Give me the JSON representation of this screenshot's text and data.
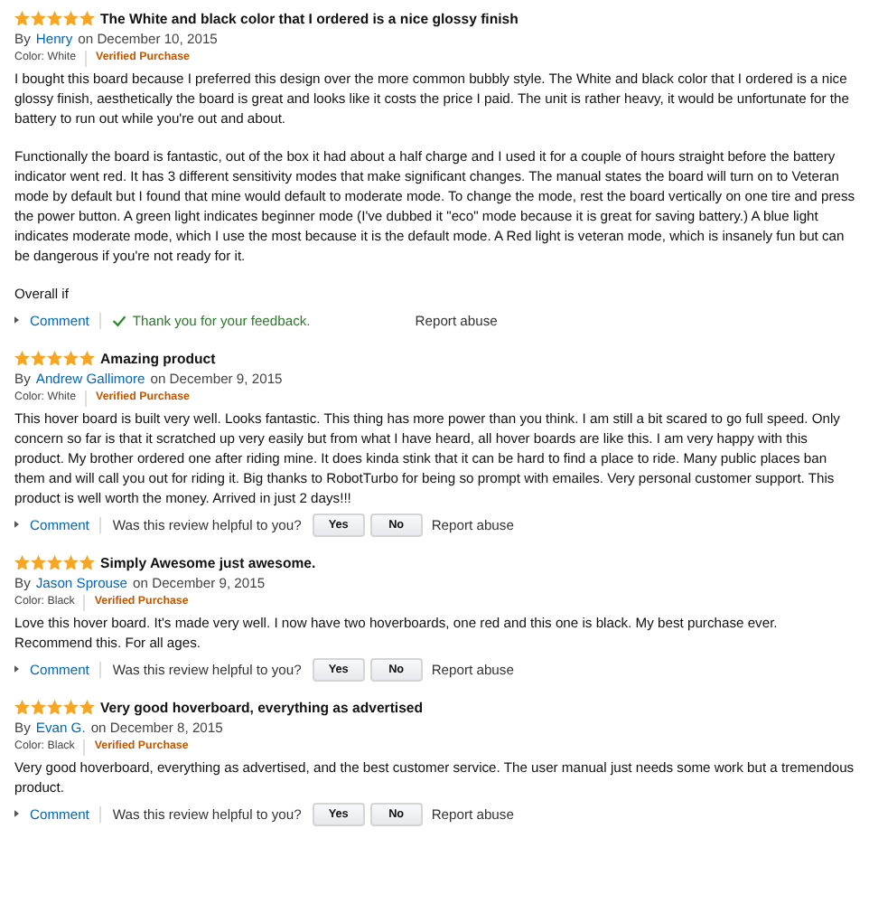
{
  "reviews": [
    {
      "stars": 5,
      "title": "The White and black color that I ordered is a nice glossy finish",
      "by": "By",
      "author": "Henry",
      "date": "on December 10, 2015",
      "variant": "Color: White",
      "verified": "Verified Purchase",
      "paragraphs": [
        "I bought this board because I preferred this design over the more common bubbly style. The White and black color that I ordered is a nice glossy finish, aesthetically the board is great and looks like it costs the price I paid. The unit is rather heavy, it would be unfortunate for the battery to run out while you're out and about.",
        "Functionally the board is fantastic, out of the box it had about a half charge and I used it for a couple of hours straight before the battery indicator went red. It has 3 different sensitivity modes that make significant changes. The manual states the board will turn on to Veteran mode by default but I found that mine would default to moderate mode. To change the mode, rest the board vertically on one tire and press the power button. A green light indicates beginner mode (I've dubbed it \"eco\" mode because it is great for saving battery.) A blue light indicates moderate mode, which I use the most because it is the default mode. A Red light is veteran mode, which is insanely fun but can be dangerous if you're not ready for it.",
        "Overall if"
      ],
      "footer": {
        "kind": "thanked",
        "comment": "Comment",
        "message": "Thank you for your feedback.",
        "report": "Report abuse"
      }
    },
    {
      "stars": 5,
      "title": "Amazing product",
      "by": "By",
      "author": "Andrew Gallimore",
      "date": "on December 9, 2015",
      "variant": "Color: White",
      "verified": "Verified Purchase",
      "paragraphs": [
        "This hover board is built very well. Looks fantastic. This thing has more power than you think. I am still a bit scared to go full speed. Only concern so far is that it scratched up very easily but from what I have heard, all hover boards are like this. I am very happy with this product. My brother ordered one after riding mine. It does kinda stink that it can be hard to find a place to ride. Many public places ban them and will call you out for riding it. Big thanks to RobotTurbo for being so prompt with emailes. Very personal customer support. This product is well worth the money. Arrived in just 2 days!!!"
      ],
      "footer": {
        "kind": "vote",
        "comment": "Comment",
        "message": "Was this review helpful to you?",
        "yes": "Yes",
        "no": "No",
        "report": "Report abuse"
      }
    },
    {
      "stars": 5,
      "title": "Simply Awesome just awesome.",
      "by": "By",
      "author": "Jason Sprouse",
      "date": "on December 9, 2015",
      "variant": "Color: Black",
      "verified": "Verified Purchase",
      "paragraphs": [
        "Love this hover board. It's made very well. I now have two hoverboards, one red and this one is black. My best purchase ever. Recommend this. For all ages."
      ],
      "footer": {
        "kind": "vote",
        "comment": "Comment",
        "message": "Was this review helpful to you?",
        "yes": "Yes",
        "no": "No",
        "report": "Report abuse"
      }
    },
    {
      "stars": 5,
      "title": "Very good hoverboard, everything as advertised",
      "by": "By",
      "author": "Evan G.",
      "date": "on December 8, 2015",
      "variant": "Color: Black",
      "verified": "Verified Purchase",
      "paragraphs": [
        "Very good hoverboard, everything as advertised, and the best customer service. The user manual just needs some work but a tremendous product."
      ],
      "footer": {
        "kind": "vote",
        "comment": "Comment",
        "message": "Was this review helpful to you?",
        "yes": "Yes",
        "no": "No",
        "report": "Report abuse"
      }
    }
  ]
}
